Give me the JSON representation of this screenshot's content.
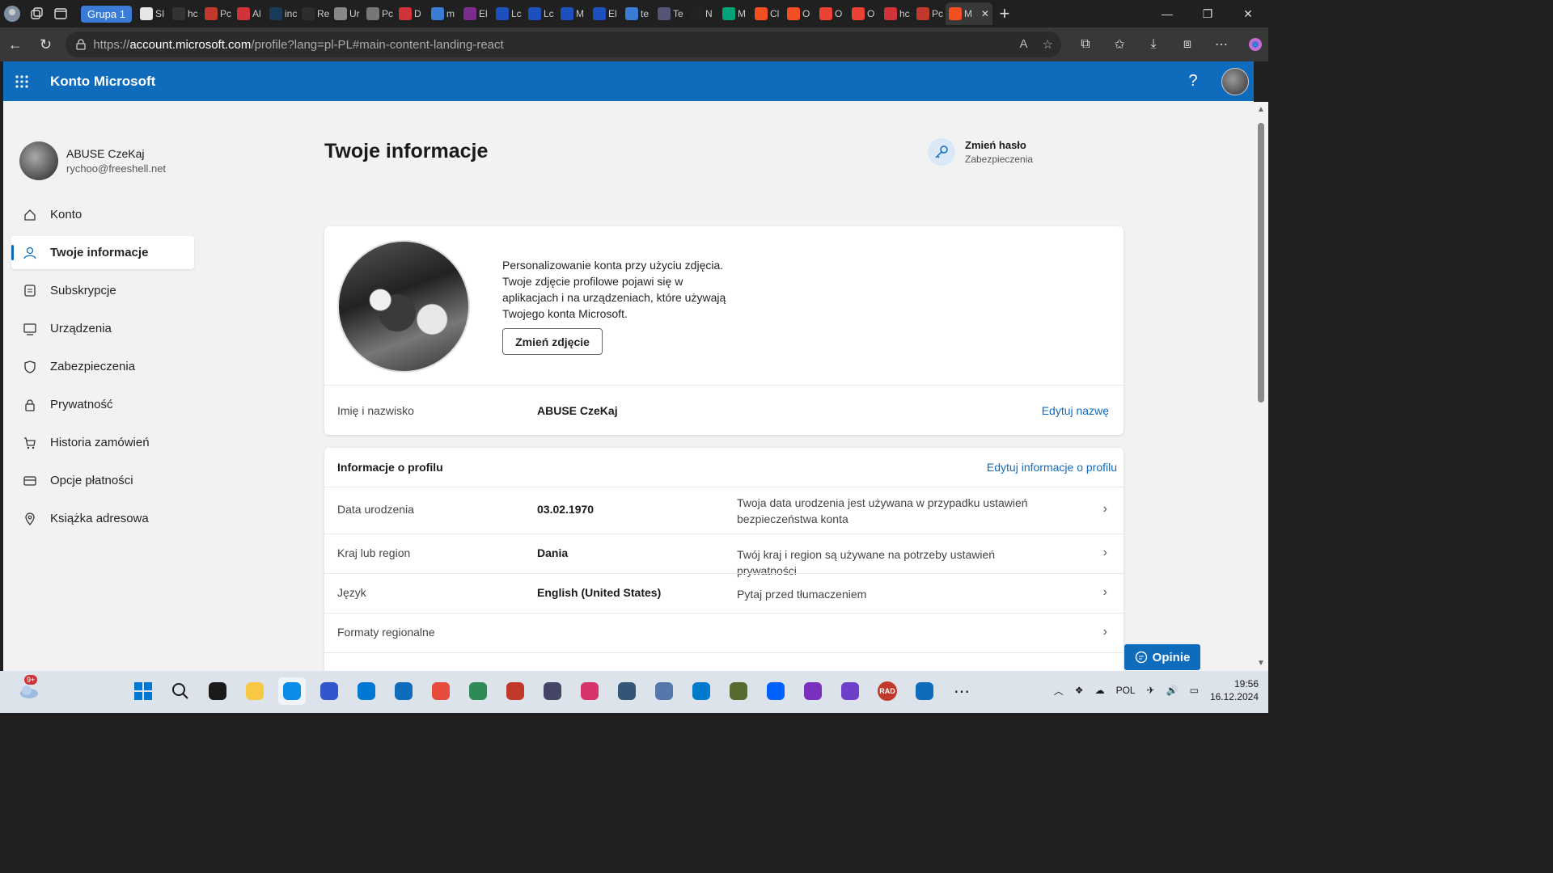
{
  "browser": {
    "group_label": "Grupa 1",
    "tabs": [
      {
        "title": "SI",
        "color": "#e6e6e6"
      },
      {
        "title": "hc",
        "color": "#333333"
      },
      {
        "title": "Pc",
        "color": "#c0392b"
      },
      {
        "title": "Al",
        "color": "#d13438"
      },
      {
        "title": "inc",
        "color": "#1a3a5a"
      },
      {
        "title": "Re",
        "color": "#2d2d2d"
      },
      {
        "title": "Ur",
        "color": "#888888"
      },
      {
        "title": "Pc",
        "color": "#777777"
      },
      {
        "title": "D",
        "color": "#d13438"
      },
      {
        "title": "m",
        "color": "#3a7bd5"
      },
      {
        "title": "El",
        "color": "#7b2d8e"
      },
      {
        "title": "Lc",
        "color": "#1e4fbf"
      },
      {
        "title": "Lc",
        "color": "#1e4fbf"
      },
      {
        "title": "M",
        "color": "#1e4fbf"
      },
      {
        "title": "El",
        "color": "#1e4fbf"
      },
      {
        "title": "te",
        "color": "#3a7bd5"
      },
      {
        "title": "Te",
        "color": "#555577"
      },
      {
        "title": "N",
        "color": "#222222"
      },
      {
        "title": "M",
        "color": "#00a37a"
      },
      {
        "title": "Cl",
        "color": "#f25022"
      },
      {
        "title": "O",
        "color": "#f25022"
      },
      {
        "title": "O",
        "color": "#ea4335"
      },
      {
        "title": "O",
        "color": "#ea4335"
      },
      {
        "title": "hc",
        "color": "#d13438"
      },
      {
        "title": "Pc",
        "color": "#c0392b"
      }
    ],
    "active_tab": {
      "title": "M"
    },
    "url_host": "account.microsoft.com",
    "url_prefix": "https://",
    "url_path": "/profile?lang=pl-PL#main-content-landing-react"
  },
  "header": {
    "brand": "Konto Microsoft",
    "help": "?"
  },
  "user": {
    "name": "ABUSE CzeKaj",
    "email": "rychoo@freeshell.net"
  },
  "nav": [
    {
      "label": "Konto",
      "icon": "home-icon"
    },
    {
      "label": "Twoje informacje",
      "icon": "person-icon",
      "active": true
    },
    {
      "label": "Subskrypcje",
      "icon": "subscriptions-icon"
    },
    {
      "label": "Urządzenia",
      "icon": "laptop-icon"
    },
    {
      "label": "Zabezpieczenia",
      "icon": "shield-icon"
    },
    {
      "label": "Prywatność",
      "icon": "lock-icon"
    },
    {
      "label": "Historia zamówień",
      "icon": "cart-icon"
    },
    {
      "label": "Opcje płatności",
      "icon": "card-icon"
    },
    {
      "label": "Książka adresowa",
      "icon": "location-icon"
    }
  ],
  "main": {
    "title": "Twoje informacje",
    "password": {
      "title": "Zmień hasło",
      "subtitle": "Zabezpieczenia"
    },
    "photo": {
      "description": "Personalizowanie konta przy użyciu zdjęcia. Twoje zdjęcie profilowe pojawi się w aplikacjach i na urządzeniach, które używają Twojego konta Microsoft.",
      "button": "Zmień zdjęcie"
    },
    "name_row": {
      "label": "Imię i nazwisko",
      "value": "ABUSE CzeKaj",
      "action": "Edytuj nazwę"
    },
    "profile": {
      "heading": "Informacje o profilu",
      "action": "Edytuj informacje o profilu",
      "rows": [
        {
          "label": "Data urodzenia",
          "value": "03.02.1970",
          "desc": "Twoja data urodzenia jest używana w przypadku ustawień bezpieczeństwa konta"
        },
        {
          "label": "Kraj lub region",
          "value": "Dania",
          "desc": "Twój kraj i region są używane na potrzeby ustawień prywatności"
        },
        {
          "label": "Język",
          "value": "English (United States)",
          "desc": "Pytaj przed tłumaczeniem"
        },
        {
          "label": "Formaty regionalne",
          "value": "",
          "desc": ""
        }
      ]
    },
    "feedback": "Opinie"
  },
  "taskbar": {
    "weather_badge": "9+",
    "language": "POL",
    "time": "19:56",
    "date": "16.12.2024",
    "apps": [
      {
        "name": "start-icon",
        "color": "#0078d4"
      },
      {
        "name": "search-icon",
        "color": "#1a1a1a"
      },
      {
        "name": "taskview-icon",
        "color": "#1a1a1a"
      },
      {
        "name": "file-explorer-icon",
        "color": "#f7c843"
      },
      {
        "name": "edge-icon",
        "color": "#0c8ce9",
        "active": true
      },
      {
        "name": "save-icon",
        "color": "#3355cc"
      },
      {
        "name": "store-icon",
        "color": "#0078d4"
      },
      {
        "name": "outlook-icon",
        "color": "#0f6cbd"
      },
      {
        "name": "colorful-app-icon",
        "color": "#e74c3c"
      },
      {
        "name": "green-app-icon",
        "color": "#2e8b57"
      },
      {
        "name": "red-app-icon",
        "color": "#c0392b"
      },
      {
        "name": "box-app-icon",
        "color": "#444466"
      },
      {
        "name": "pink-app-icon",
        "color": "#d6336c"
      },
      {
        "name": "network-app-icon",
        "color": "#335577"
      },
      {
        "name": "settings-icon",
        "color": "#5577aa"
      },
      {
        "name": "vscode-icon",
        "color": "#007acc"
      },
      {
        "name": "tool-app-icon",
        "color": "#556b2f"
      },
      {
        "name": "dropbox-icon",
        "color": "#0061fe"
      },
      {
        "name": "purple-app-icon",
        "color": "#7b2fbe"
      },
      {
        "name": "github-icon",
        "color": "#6e40c9"
      },
      {
        "name": "rad-app-icon",
        "color": "#c0392b"
      },
      {
        "name": "defender-icon",
        "color": "#0f6cbd"
      },
      {
        "name": "more-icon",
        "color": "#1a1a1a"
      }
    ],
    "rad_label": "RAD"
  }
}
